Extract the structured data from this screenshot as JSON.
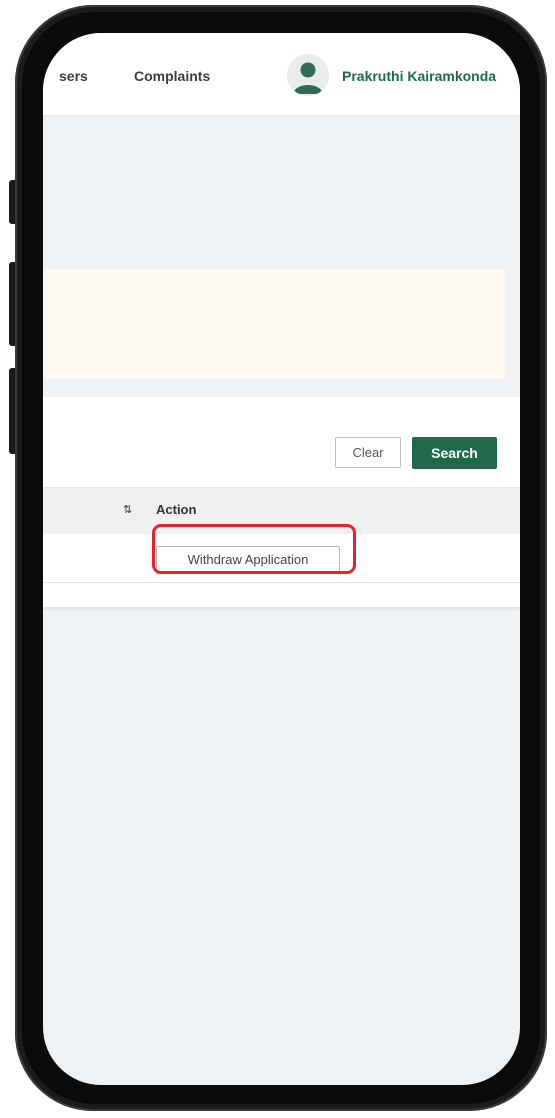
{
  "header": {
    "nav_partial_label": "sers",
    "nav_complaints_label": "Complaints",
    "user_name": "Prakruthi Kairamkonda",
    "avatar_icon": "user-avatar-icon"
  },
  "filters": {
    "clear_label": "Clear",
    "search_label": "Search"
  },
  "table": {
    "sort_icon_glyph": "⇅",
    "columns": [
      "Action"
    ],
    "rows": [
      {
        "action_label": "Withdraw Application"
      }
    ]
  },
  "colors": {
    "brand_green": "#1f6a4c",
    "screen_bg": "#eff2f5",
    "notice_bg": "#fdf7f2",
    "highlight_red": "#e8222a"
  }
}
